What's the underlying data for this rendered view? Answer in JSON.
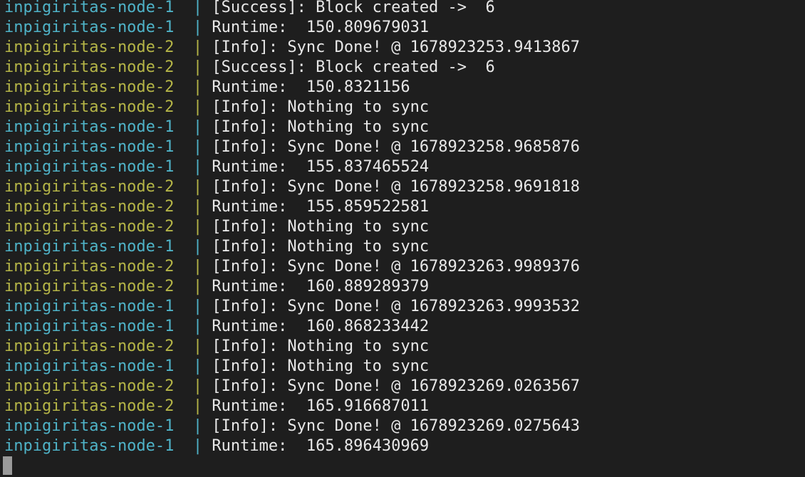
{
  "terminal": {
    "colors": {
      "background": "#1e1e1e",
      "text": "#e8e8e8",
      "node_1": "#4fb3c8",
      "node_2": "#b5b547",
      "cursor": "#9a9a9a"
    },
    "lines": [
      {
        "node": "inpigiritas-node-1 ",
        "node_color": "node-1",
        "sep": " | ",
        "msg": "[Success]: Block created ->  6"
      },
      {
        "node": "inpigiritas-node-1 ",
        "node_color": "node-1",
        "sep": " | ",
        "msg": "Runtime:  150.809679031"
      },
      {
        "node": "inpigiritas-node-2 ",
        "node_color": "node-2",
        "sep": " | ",
        "msg": "[Info]: Sync Done! @ 1678923253.9413867"
      },
      {
        "node": "inpigiritas-node-2 ",
        "node_color": "node-2",
        "sep": " | ",
        "msg": "[Success]: Block created ->  6"
      },
      {
        "node": "inpigiritas-node-2 ",
        "node_color": "node-2",
        "sep": " | ",
        "msg": "Runtime:  150.8321156"
      },
      {
        "node": "inpigiritas-node-2 ",
        "node_color": "node-2",
        "sep": " | ",
        "msg": "[Info]: Nothing to sync"
      },
      {
        "node": "inpigiritas-node-1 ",
        "node_color": "node-1",
        "sep": " | ",
        "msg": "[Info]: Nothing to sync"
      },
      {
        "node": "inpigiritas-node-1 ",
        "node_color": "node-1",
        "sep": " | ",
        "msg": "[Info]: Sync Done! @ 1678923258.9685876"
      },
      {
        "node": "inpigiritas-node-1 ",
        "node_color": "node-1",
        "sep": " | ",
        "msg": "Runtime:  155.837465524"
      },
      {
        "node": "inpigiritas-node-2 ",
        "node_color": "node-2",
        "sep": " | ",
        "msg": "[Info]: Sync Done! @ 1678923258.9691818"
      },
      {
        "node": "inpigiritas-node-2 ",
        "node_color": "node-2",
        "sep": " | ",
        "msg": "Runtime:  155.859522581"
      },
      {
        "node": "inpigiritas-node-2 ",
        "node_color": "node-2",
        "sep": " | ",
        "msg": "[Info]: Nothing to sync"
      },
      {
        "node": "inpigiritas-node-1 ",
        "node_color": "node-1",
        "sep": " | ",
        "msg": "[Info]: Nothing to sync"
      },
      {
        "node": "inpigiritas-node-2 ",
        "node_color": "node-2",
        "sep": " | ",
        "msg": "[Info]: Sync Done! @ 1678923263.9989376"
      },
      {
        "node": "inpigiritas-node-2 ",
        "node_color": "node-2",
        "sep": " | ",
        "msg": "Runtime:  160.889289379"
      },
      {
        "node": "inpigiritas-node-1 ",
        "node_color": "node-1",
        "sep": " | ",
        "msg": "[Info]: Sync Done! @ 1678923263.9993532"
      },
      {
        "node": "inpigiritas-node-1 ",
        "node_color": "node-1",
        "sep": " | ",
        "msg": "Runtime:  160.868233442"
      },
      {
        "node": "inpigiritas-node-2 ",
        "node_color": "node-2",
        "sep": " | ",
        "msg": "[Info]: Nothing to sync"
      },
      {
        "node": "inpigiritas-node-1 ",
        "node_color": "node-1",
        "sep": " | ",
        "msg": "[Info]: Nothing to sync"
      },
      {
        "node": "inpigiritas-node-2 ",
        "node_color": "node-2",
        "sep": " | ",
        "msg": "[Info]: Sync Done! @ 1678923269.0263567"
      },
      {
        "node": "inpigiritas-node-2 ",
        "node_color": "node-2",
        "sep": " | ",
        "msg": "Runtime:  165.916687011"
      },
      {
        "node": "inpigiritas-node-1 ",
        "node_color": "node-1",
        "sep": " | ",
        "msg": "[Info]: Sync Done! @ 1678923269.0275643"
      },
      {
        "node": "inpigiritas-node-1 ",
        "node_color": "node-1",
        "sep": " | ",
        "msg": "Runtime:  165.896430969"
      }
    ]
  }
}
